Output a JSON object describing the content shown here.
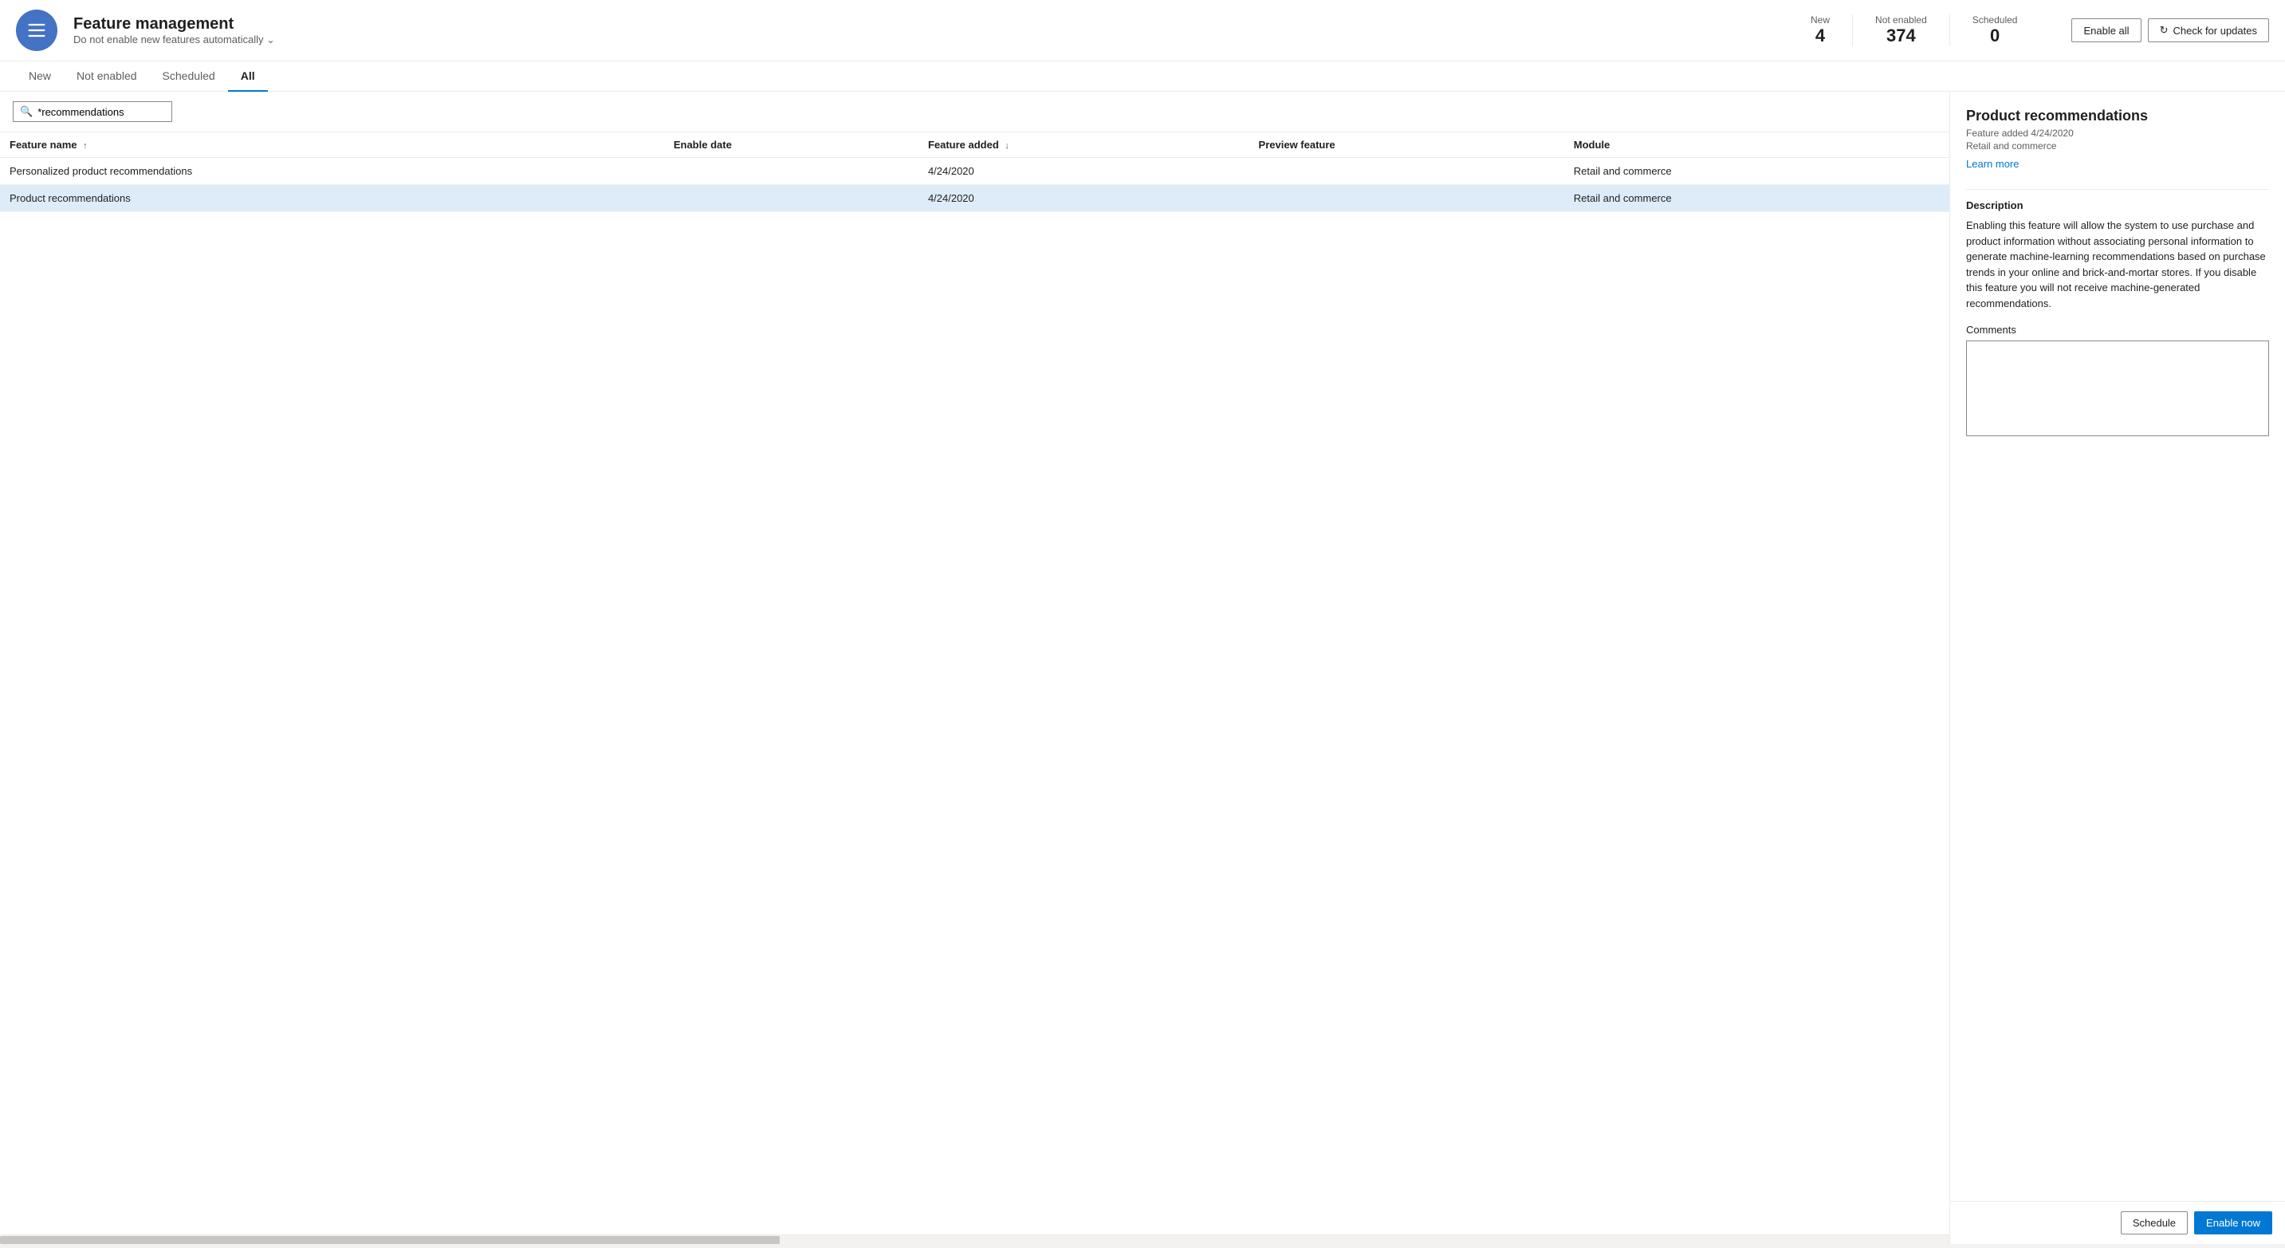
{
  "header": {
    "title": "Feature management",
    "subtitle": "Do not enable new features automatically",
    "icon_label": "feature-management-icon",
    "stats": {
      "new_label": "New",
      "new_value": "4",
      "not_enabled_label": "Not enabled",
      "not_enabled_value": "374",
      "scheduled_label": "Scheduled",
      "scheduled_value": "0"
    },
    "enable_all_label": "Enable all",
    "check_updates_label": "Check for updates"
  },
  "tabs": [
    {
      "id": "new",
      "label": "New"
    },
    {
      "id": "not-enabled",
      "label": "Not enabled"
    },
    {
      "id": "scheduled",
      "label": "Scheduled"
    },
    {
      "id": "all",
      "label": "All",
      "active": true
    }
  ],
  "search": {
    "value": "*recommendations",
    "placeholder": "Search"
  },
  "table": {
    "columns": [
      {
        "id": "feature-name",
        "label": "Feature name",
        "sort": "asc"
      },
      {
        "id": "enable-date",
        "label": "Enable date",
        "sort": null
      },
      {
        "id": "feature-added",
        "label": "Feature added",
        "sort": "desc"
      },
      {
        "id": "preview-feature",
        "label": "Preview feature",
        "sort": null
      },
      {
        "id": "module",
        "label": "Module",
        "sort": null
      }
    ],
    "rows": [
      {
        "id": "row-1",
        "feature_name": "Personalized product recommendations",
        "enable_date": "",
        "feature_added": "4/24/2020",
        "preview_feature": "",
        "module": "Retail and commerce",
        "selected": false
      },
      {
        "id": "row-2",
        "feature_name": "Product recommendations",
        "enable_date": "",
        "feature_added": "4/24/2020",
        "preview_feature": "",
        "module": "Retail and commerce",
        "selected": true
      }
    ]
  },
  "detail": {
    "title": "Product recommendations",
    "feature_added_label": "Feature added 4/24/2020",
    "module": "Retail and commerce",
    "learn_more_label": "Learn more",
    "description_title": "Description",
    "description_text": "Enabling this feature will allow the system to use purchase and product information without associating personal information to generate machine-learning recommendations based on purchase trends in your online and brick-and-mortar stores. If you disable this feature you will not receive machine-generated recommendations.",
    "comments_label": "Comments",
    "schedule_label": "Schedule",
    "enable_now_label": "Enable now"
  }
}
